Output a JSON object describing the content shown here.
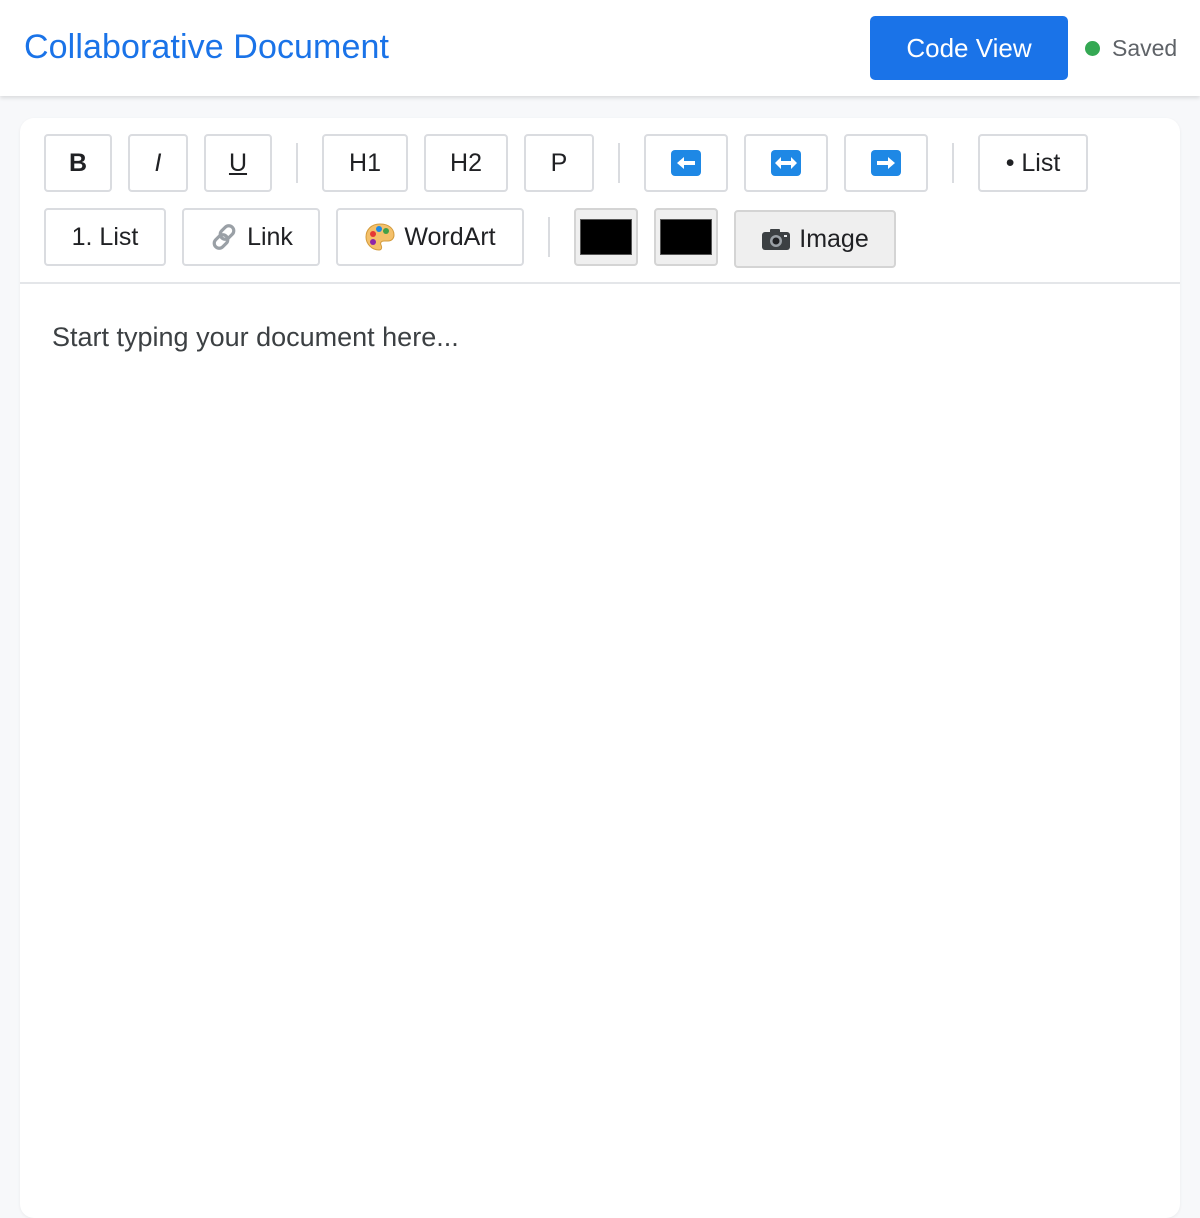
{
  "header": {
    "title": "Collaborative Document",
    "code_view_label": "Code View",
    "status_text": "Saved",
    "status_color": "#34a853",
    "accent_color": "#1a73e8"
  },
  "toolbar": {
    "bold": "B",
    "italic": "I",
    "underline": "U",
    "h1": "H1",
    "h2": "H2",
    "paragraph": "P",
    "align_left_icon": "left-arrow-icon",
    "align_center_icon": "left-right-arrow-icon",
    "align_right_icon": "right-arrow-icon",
    "bullet_list": "• List",
    "numbered_list": "1. List",
    "link": "Link",
    "link_icon": "link-icon",
    "wordart": "WordArt",
    "wordart_icon": "palette-icon",
    "text_color": "#000000",
    "highlight_color": "#000000",
    "image": "Image",
    "image_icon": "camera-icon"
  },
  "editor": {
    "placeholder": "Start typing your document here..."
  }
}
